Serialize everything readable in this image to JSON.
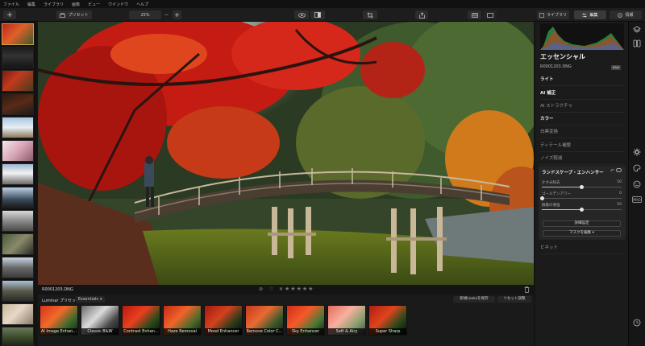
{
  "menu": [
    "ファイル",
    "編集",
    "ライブラリ",
    "画像",
    "ビュー",
    "ウインドウ",
    "ヘルプ"
  ],
  "toolbar": {
    "add_icon": "plus-icon",
    "preset_label": "プリセット",
    "zoom_value": "25%",
    "tab_library": "ライブラリ",
    "tab_edit": "編集",
    "tab_info": "情報"
  },
  "photo": {
    "filename": "R0001203.DNG"
  },
  "rating": {
    "stars": 0,
    "max": 5
  },
  "presets": {
    "group_title": "Luminar プリセット",
    "category": "Essentials",
    "save_button": "新規Looksを保存",
    "reset_button": "リセット調整",
    "items": [
      "AI Image Enhan...",
      "Classic B&W",
      "Contrast Enhan...",
      "Haze Removal",
      "Mood Enhancer",
      "Remove Color C...",
      "Sky Enhancer",
      "Soft & Airy",
      "Super Sharp"
    ]
  },
  "panel": {
    "title": "エッセンシャル",
    "filename": "R0001203.DNG",
    "raw_badge": "RAW",
    "sections": {
      "light": "ライト",
      "ai_enhance": "AI 補正",
      "ai_structure": "AI ストラクチャ",
      "color": "カラー",
      "bw": "白黒変換",
      "details": "ディテール補整",
      "denoise": "ノイズ軽減",
      "landscape": "ランドスケープ・エンハンサー",
      "vignette": "ビネット"
    },
    "landscape_sliders": [
      {
        "name": "かすみ除去",
        "value": "50",
        "level": 0.5
      },
      {
        "name": "ゴールデンアワー",
        "value": "0",
        "level": 0.0
      },
      {
        "name": "群葉の増強",
        "value": "50",
        "level": 0.5
      }
    ],
    "advanced_button": "詳細設定",
    "mask_button": "マスクを編集 ▾"
  },
  "colors": {
    "accent": "#6f8fd8",
    "panel_bg": "#1b1b1b"
  }
}
